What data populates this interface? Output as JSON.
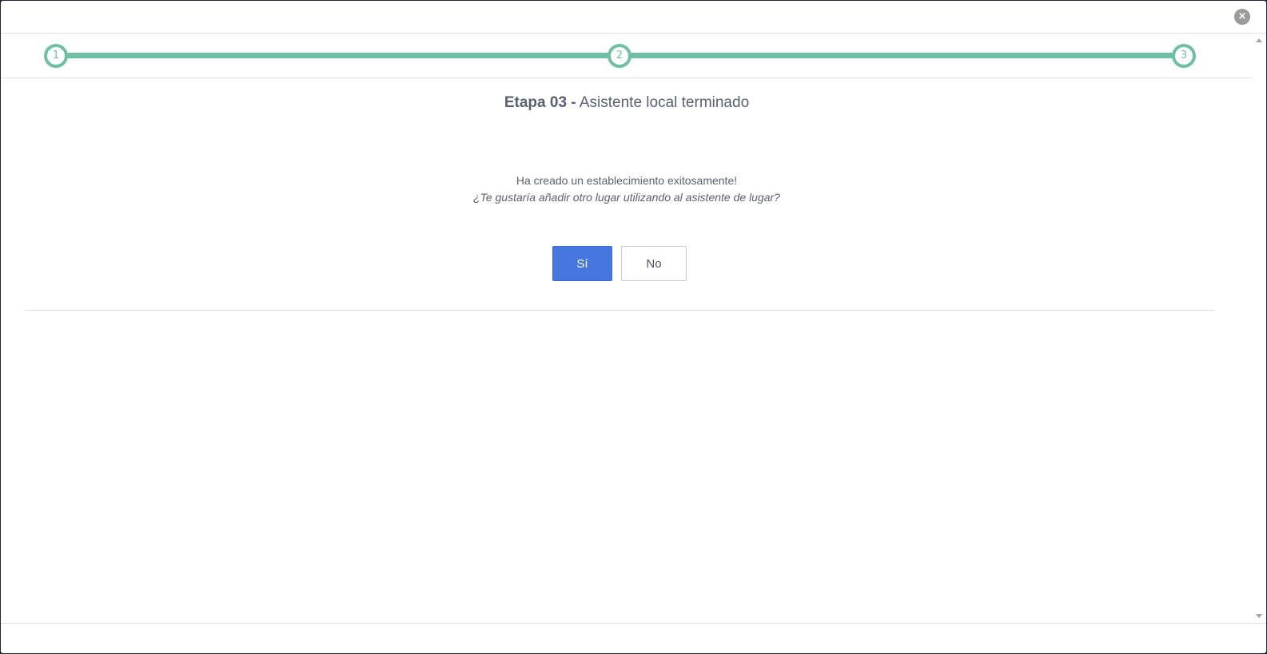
{
  "header": {
    "close_icon": "×"
  },
  "stepper": {
    "steps": [
      {
        "label": "1"
      },
      {
        "label": "2"
      },
      {
        "label": "3"
      }
    ],
    "color": "#6fbfa6"
  },
  "main": {
    "title_bold": "Etapa 03 -",
    "title_rest": " Asistente local terminado",
    "message": "Ha creado un establecimiento exitosamente!",
    "question": "¿Te gustaría añadir otro lugar utilizando al asistente de lugar?",
    "yes_label": "Sí",
    "no_label": "No"
  },
  "colors": {
    "primary": "#4677df",
    "text": "#5b5f70"
  }
}
